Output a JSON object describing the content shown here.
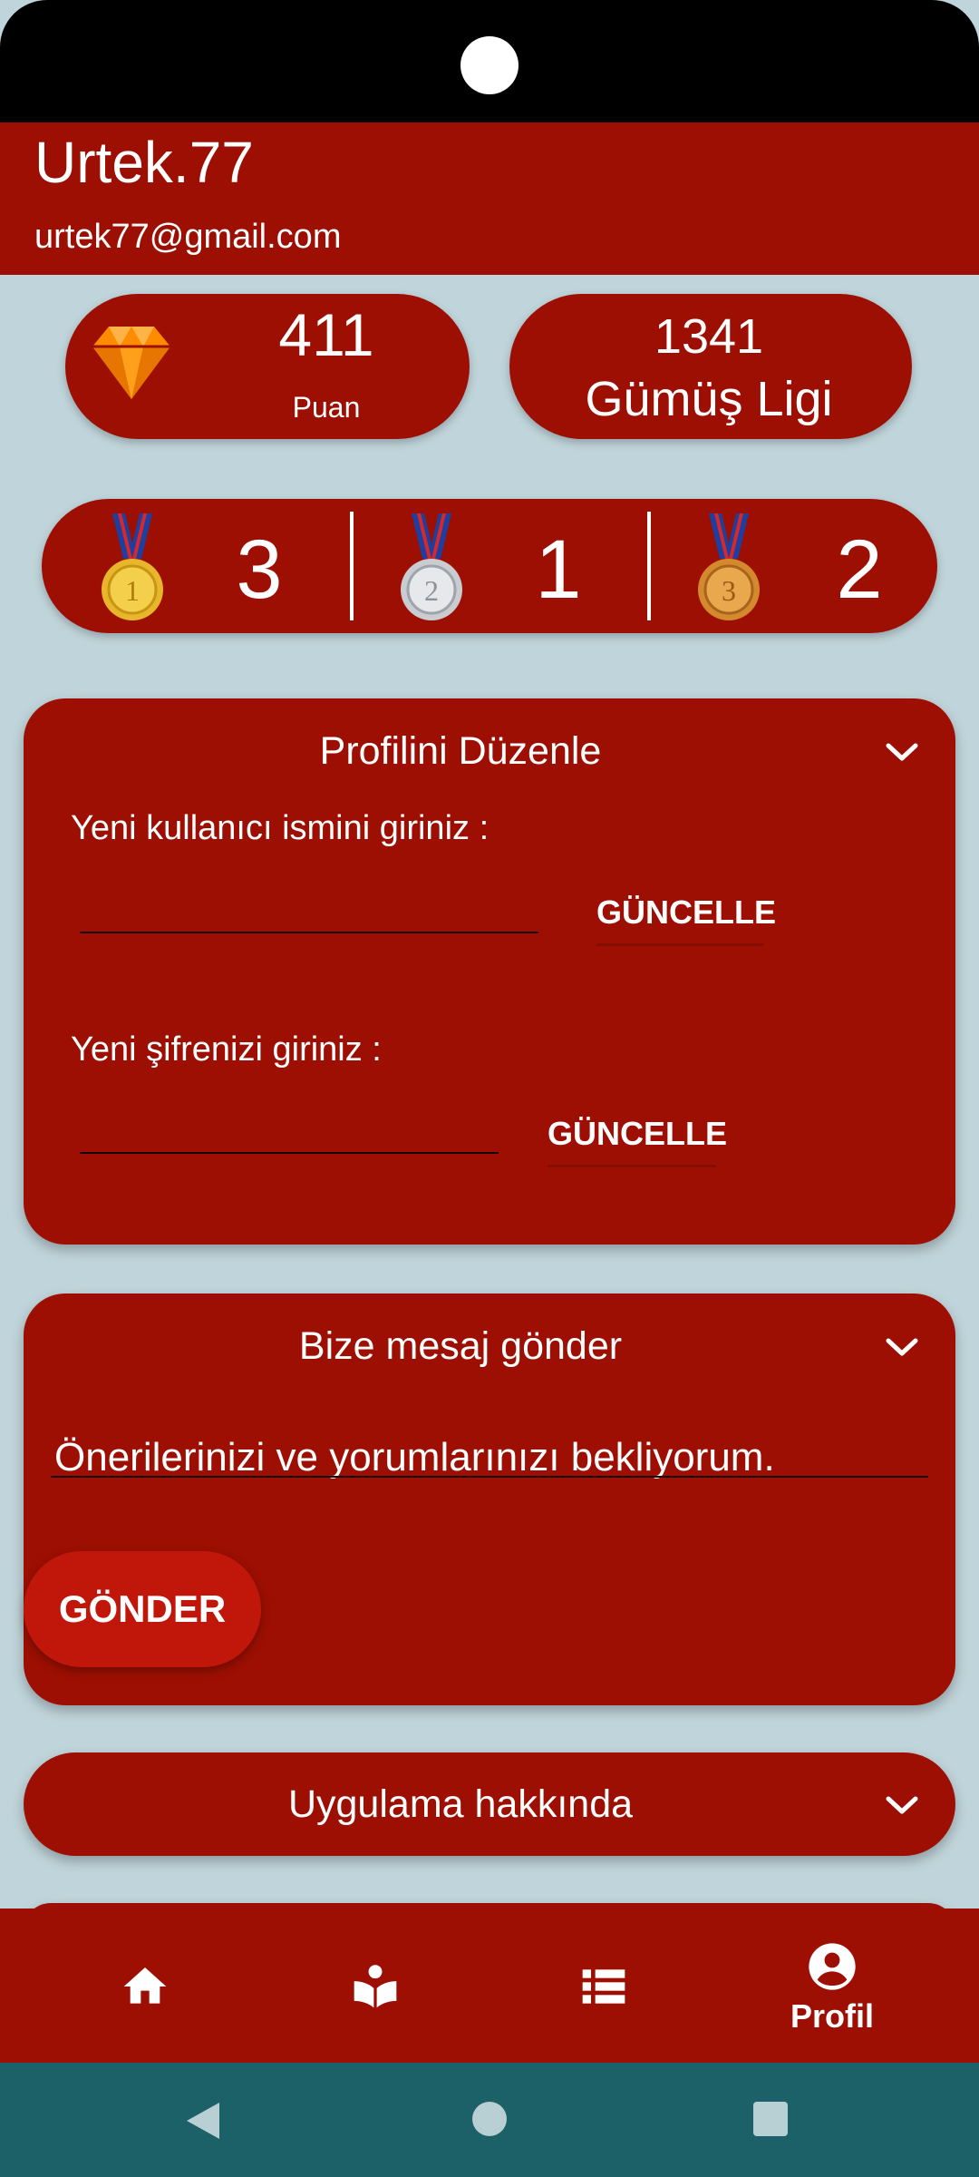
{
  "profile": {
    "username": "Urtek.77",
    "email": "urtek77@gmail.com"
  },
  "stats": {
    "score_value": "411",
    "score_label": "Puan",
    "league_points": "1341",
    "league_name": "Gümüş Ligi"
  },
  "medals": {
    "gold_count": "3",
    "silver_count": "1",
    "bronze_count": "2"
  },
  "edit_profile": {
    "title": "Profilini Düzenle",
    "username_label": "Yeni kullanıcı ismini giriniz :",
    "username_value": "",
    "username_button": "GÜNCELLE",
    "password_label": "Yeni şifrenizi giriniz :",
    "password_value": "",
    "password_button": "GÜNCELLE"
  },
  "message": {
    "title": "Bize mesaj gönder",
    "text": "Önerilerinizi ve yorumlarınızı bekliyorum.",
    "send_button": "GÖNDER"
  },
  "about": {
    "title": "Uygulama hakkında"
  },
  "bottom_nav": {
    "items": [
      {
        "icon": "home-icon"
      },
      {
        "icon": "book-reader-icon"
      },
      {
        "icon": "list-icon"
      },
      {
        "icon": "account-circle-icon",
        "label": "Profil"
      }
    ]
  },
  "colors": {
    "primary": "#9c0f02",
    "background": "#c0d5db",
    "send_button": "#c1170a",
    "system_nav": "#1b6167",
    "gem": "#ff8c00"
  }
}
